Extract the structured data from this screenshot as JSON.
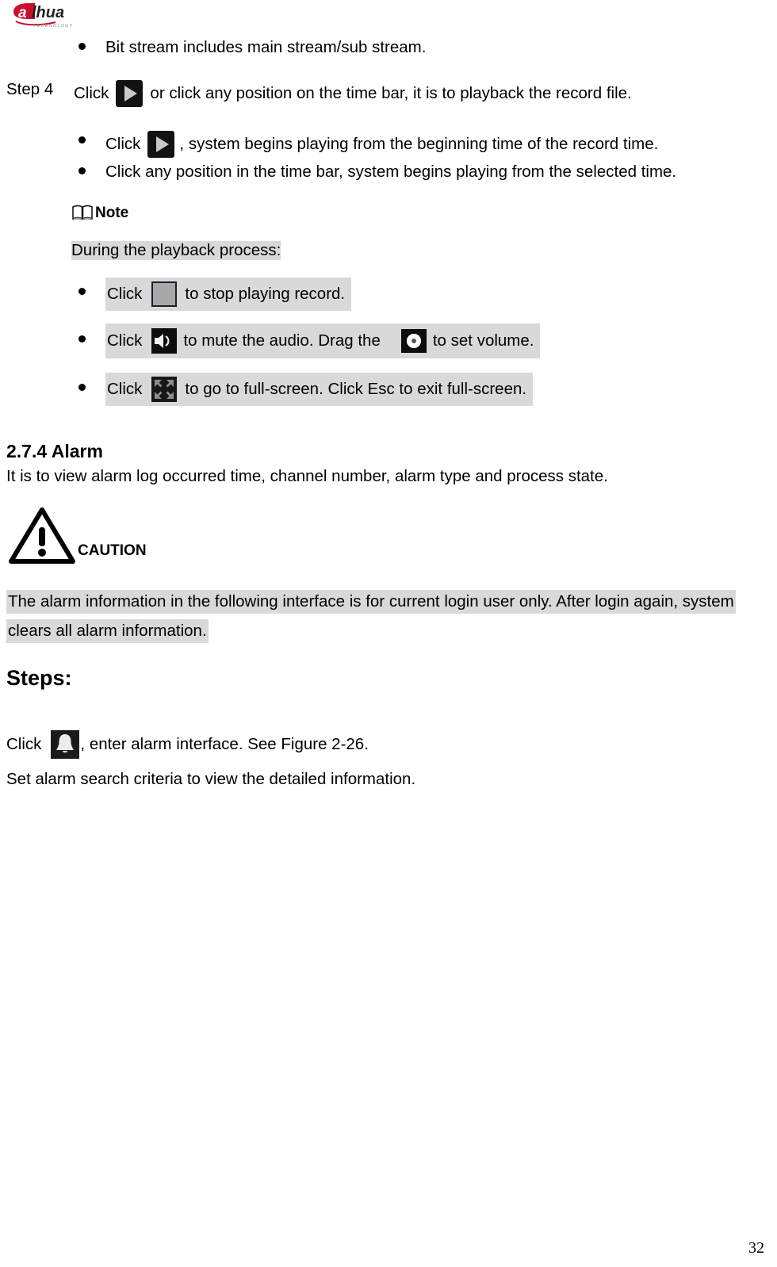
{
  "document": {
    "brand": "dahua",
    "brand_sub": "TECHNOLOGY",
    "page_number": "32"
  },
  "content": {
    "bullet_bitstream": "Bit stream includes main stream/sub stream.",
    "step4": {
      "label": "Step 4",
      "click_word": "Click",
      "icon": "play-icon",
      "text_after": "or click any position on the time bar, it is to playback the record file."
    },
    "bullet_play": {
      "click_word": "Click",
      "icon": "play-icon",
      "text_after": ", system begins playing from the beginning time of the record time."
    },
    "bullet_timebar": "Click any position in the time bar, system begins playing from the selected time.",
    "note": {
      "icon": "book-icon",
      "label": "Note",
      "intro": "During the playback process:"
    },
    "note_bullets": [
      {
        "click_word": "Click",
        "icon": "stop-icon",
        "text_after": "to stop playing record."
      },
      {
        "click_word": "Click",
        "icon": "speaker-icon",
        "text_mid": "to mute the audio. Drag the",
        "icon2": "volume-knob-icon",
        "text_after": "to set volume."
      },
      {
        "click_word": "Click",
        "icon": "fullscreen-icon",
        "text_after": "to go to full-screen. Click Esc to exit full-screen."
      }
    ],
    "section": {
      "number": "2.7.4",
      "title": "Alarm",
      "description": "It is to view alarm log occurred time, channel number, alarm type and process state."
    },
    "caution": {
      "icon": "warning-triangle-icon",
      "label": "CAUTION",
      "line1": "The alarm information in the following interface is for current login user only. After login again, system",
      "line2": "clears all alarm information."
    },
    "steps": {
      "heading": "Steps:",
      "click_word": "Click",
      "icon": "bell-icon",
      "text_after": ", enter alarm interface. See Figure 2-26.",
      "line2": "Set alarm search criteria to view the detailed information."
    }
  },
  "colors": {
    "highlight": "#d9d9d9",
    "brand_red": "#c8102e",
    "text": "#000000"
  }
}
